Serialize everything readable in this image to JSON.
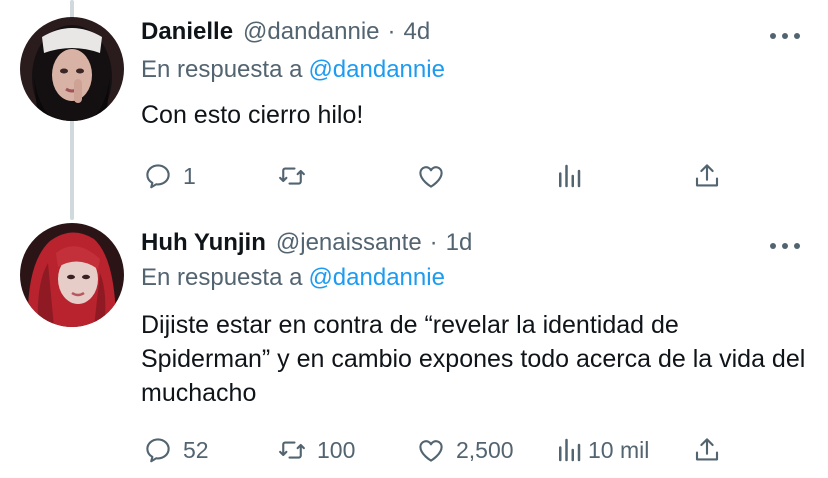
{
  "tweets": [
    {
      "author": {
        "name": "Danielle",
        "handle": "@dandannie"
      },
      "separator": "·",
      "time": "4d",
      "reply_prefix": "En respuesta a",
      "reply_mention": "@dandannie",
      "text": "Con esto cierro hilo!",
      "stats": {
        "replies": "1",
        "retweets": "",
        "likes": "",
        "views": ""
      }
    },
    {
      "author": {
        "name": "Huh Yunjin",
        "handle": "@jenaissante"
      },
      "separator": "·",
      "time": "1d",
      "reply_prefix": "En respuesta a",
      "reply_mention": "@dandannie",
      "text": "Dijiste estar en contra de “revelar la identidad de Spiderman” y en cambio expones todo acerca de la vida del muchacho",
      "stats": {
        "replies": "52",
        "retweets": "100",
        "likes": "2,500",
        "views": "10 mil"
      }
    }
  ],
  "icons": [
    "more-icon",
    "reply-icon",
    "retweet-icon",
    "like-icon",
    "views-icon",
    "share-icon"
  ],
  "colors": {
    "text": "#0f1419",
    "secondary": "#536471",
    "link": "#1d9bf0",
    "thread_line": "#cfd9de"
  }
}
